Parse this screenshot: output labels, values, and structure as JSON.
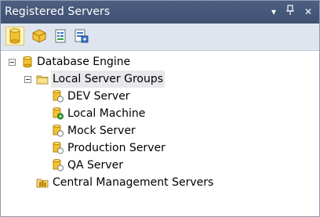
{
  "window": {
    "title": "Registered Servers",
    "buttons": {
      "dropdown": "▾",
      "pin": "⊣",
      "close": "✕"
    }
  },
  "toolbar": {
    "items": [
      {
        "icon": "database-engine-icon",
        "active": true
      },
      {
        "icon": "analysis-services-icon",
        "active": false
      },
      {
        "icon": "reporting-services-icon",
        "active": false
      },
      {
        "icon": "integration-services-icon",
        "active": false
      }
    ]
  },
  "tree": {
    "root": {
      "label": "Database Engine",
      "expanded": true
    },
    "group": {
      "label": "Local Server Groups",
      "expanded": true
    },
    "servers": [
      {
        "label": "DEV Server",
        "status": "stopped"
      },
      {
        "label": "Local Machine",
        "status": "running"
      },
      {
        "label": "Mock Server",
        "status": "stopped"
      },
      {
        "label": "Production Server",
        "status": "stopped"
      },
      {
        "label": "QA Server",
        "status": "stopped"
      }
    ],
    "central": {
      "label": "Central Management Servers"
    }
  },
  "colors": {
    "titlebar": "#45577a",
    "toolbar": "#dfe5ee",
    "db_yellow": "#f2c230",
    "running_green": "#2fa33a"
  }
}
